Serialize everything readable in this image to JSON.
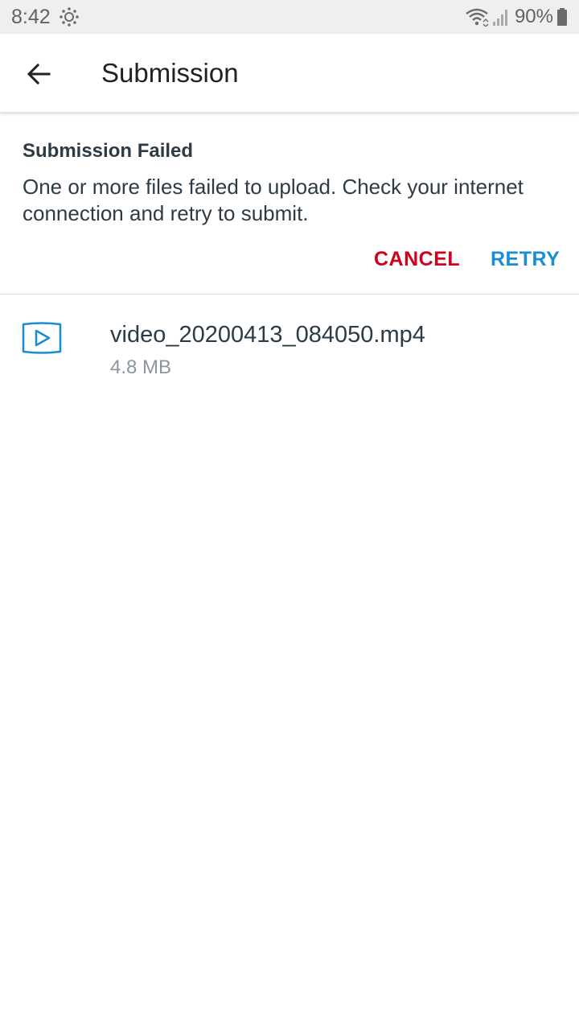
{
  "status_bar": {
    "time": "8:42",
    "battery_percent": "90%",
    "icons": [
      "canvas-logo-icon",
      "wifi-icon",
      "signal-icon",
      "battery-icon"
    ]
  },
  "app_bar": {
    "title": "Submission",
    "back_icon": "arrow-back-icon"
  },
  "alert": {
    "title": "Submission Failed",
    "message": "One or more files failed to upload. Check your internet connection and retry to submit.",
    "cancel_label": "CANCEL",
    "retry_label": "RETRY"
  },
  "files": [
    {
      "icon": "video-file-icon",
      "name": "video_20200413_084050.mp4",
      "size": "4.8 MB"
    }
  ],
  "colors": {
    "cancel": "#d0021b",
    "retry": "#1a8ed1",
    "text_primary": "#2d3b45",
    "text_secondary": "#8b969e",
    "status_bar_bg": "#efefef"
  }
}
